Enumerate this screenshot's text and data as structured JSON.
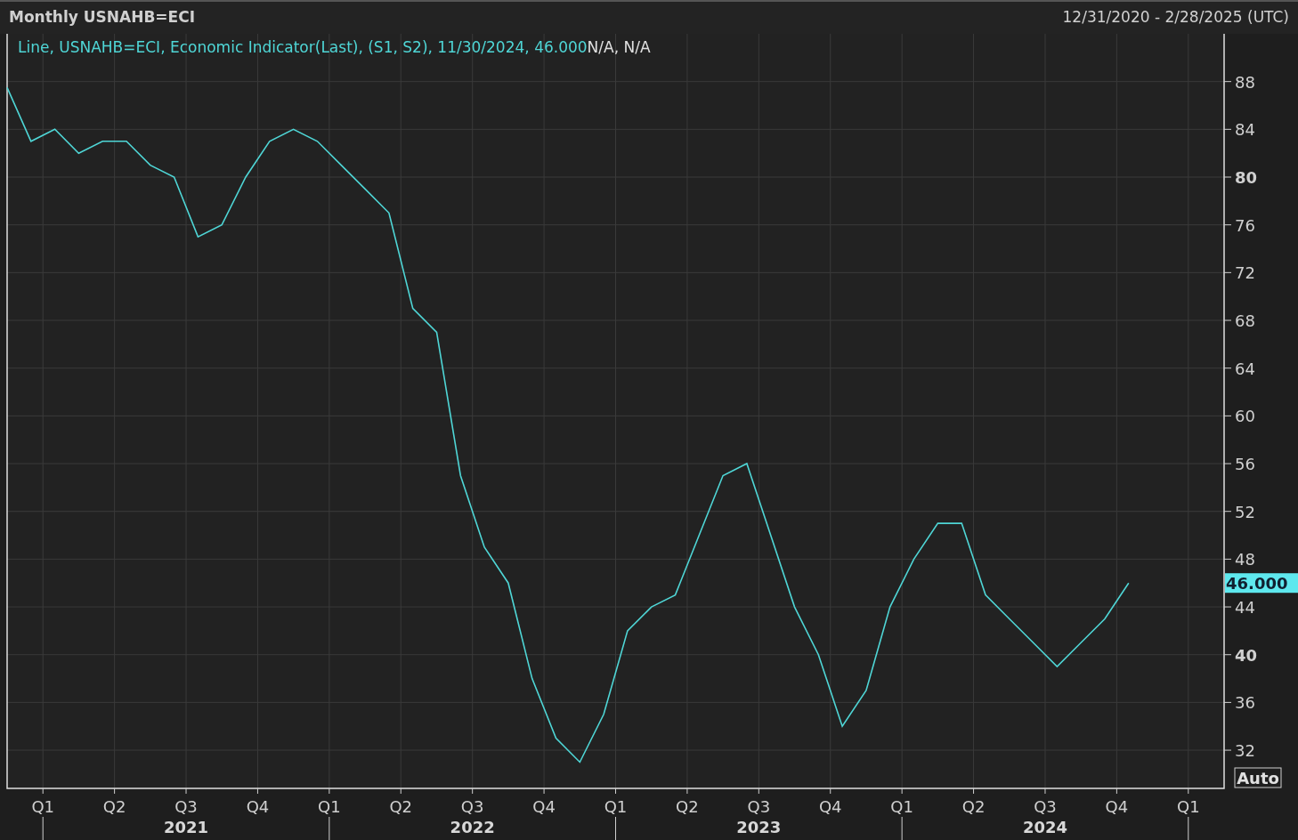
{
  "header": {
    "title": "Monthly USNAHB=ECI",
    "date_range": "12/31/2020 - 2/28/2025 (UTC)"
  },
  "legend": {
    "series_text": "Line, USNAHB=ECI, Economic Indicator(Last), (S1, S2), 11/30/2024, 46.000",
    "extra_text": "N/A, N/A"
  },
  "last_value_badge": "46.000",
  "auto_button": "Auto",
  "quarter_labels": [
    "Q1",
    "Q2",
    "Q3",
    "Q4",
    "Q1",
    "Q2",
    "Q3",
    "Q4",
    "Q1",
    "Q2",
    "Q3",
    "Q4",
    "Q1",
    "Q2",
    "Q3",
    "Q4",
    "Q1"
  ],
  "year_labels": [
    "2021",
    "2022",
    "2023",
    "2024"
  ],
  "chart_data": {
    "type": "line",
    "grid": true,
    "categories": [
      null,
      null,
      null,
      null,
      null,
      null,
      null,
      null,
      null,
      null,
      null,
      null,
      null,
      null,
      null,
      null,
      null,
      null,
      null,
      null,
      null,
      null,
      null,
      null,
      null,
      null,
      null,
      null,
      null,
      null,
      null,
      null,
      null,
      null,
      null,
      null,
      null,
      null,
      null,
      null,
      null,
      null,
      null,
      null,
      null,
      null,
      null,
      null
    ],
    "series": [
      {
        "color": "#4fd6d6",
        "values": [
          87.5,
          83,
          84,
          82,
          83,
          83,
          81,
          80,
          75,
          76,
          80,
          83,
          84,
          83,
          81,
          79,
          77,
          69,
          67,
          55,
          49,
          46,
          38,
          33,
          31,
          35,
          42,
          44,
          45,
          50,
          55,
          56,
          50,
          44,
          40,
          34,
          37,
          44,
          48,
          51,
          51,
          45,
          43,
          41,
          39,
          41,
          43,
          46
        ]
      }
    ],
    "ylim": [
      28.8,
      92
    ],
    "yticks": [
      32,
      36,
      40,
      44,
      48,
      52,
      56,
      60,
      64,
      68,
      72,
      76,
      80,
      84,
      88
    ]
  }
}
